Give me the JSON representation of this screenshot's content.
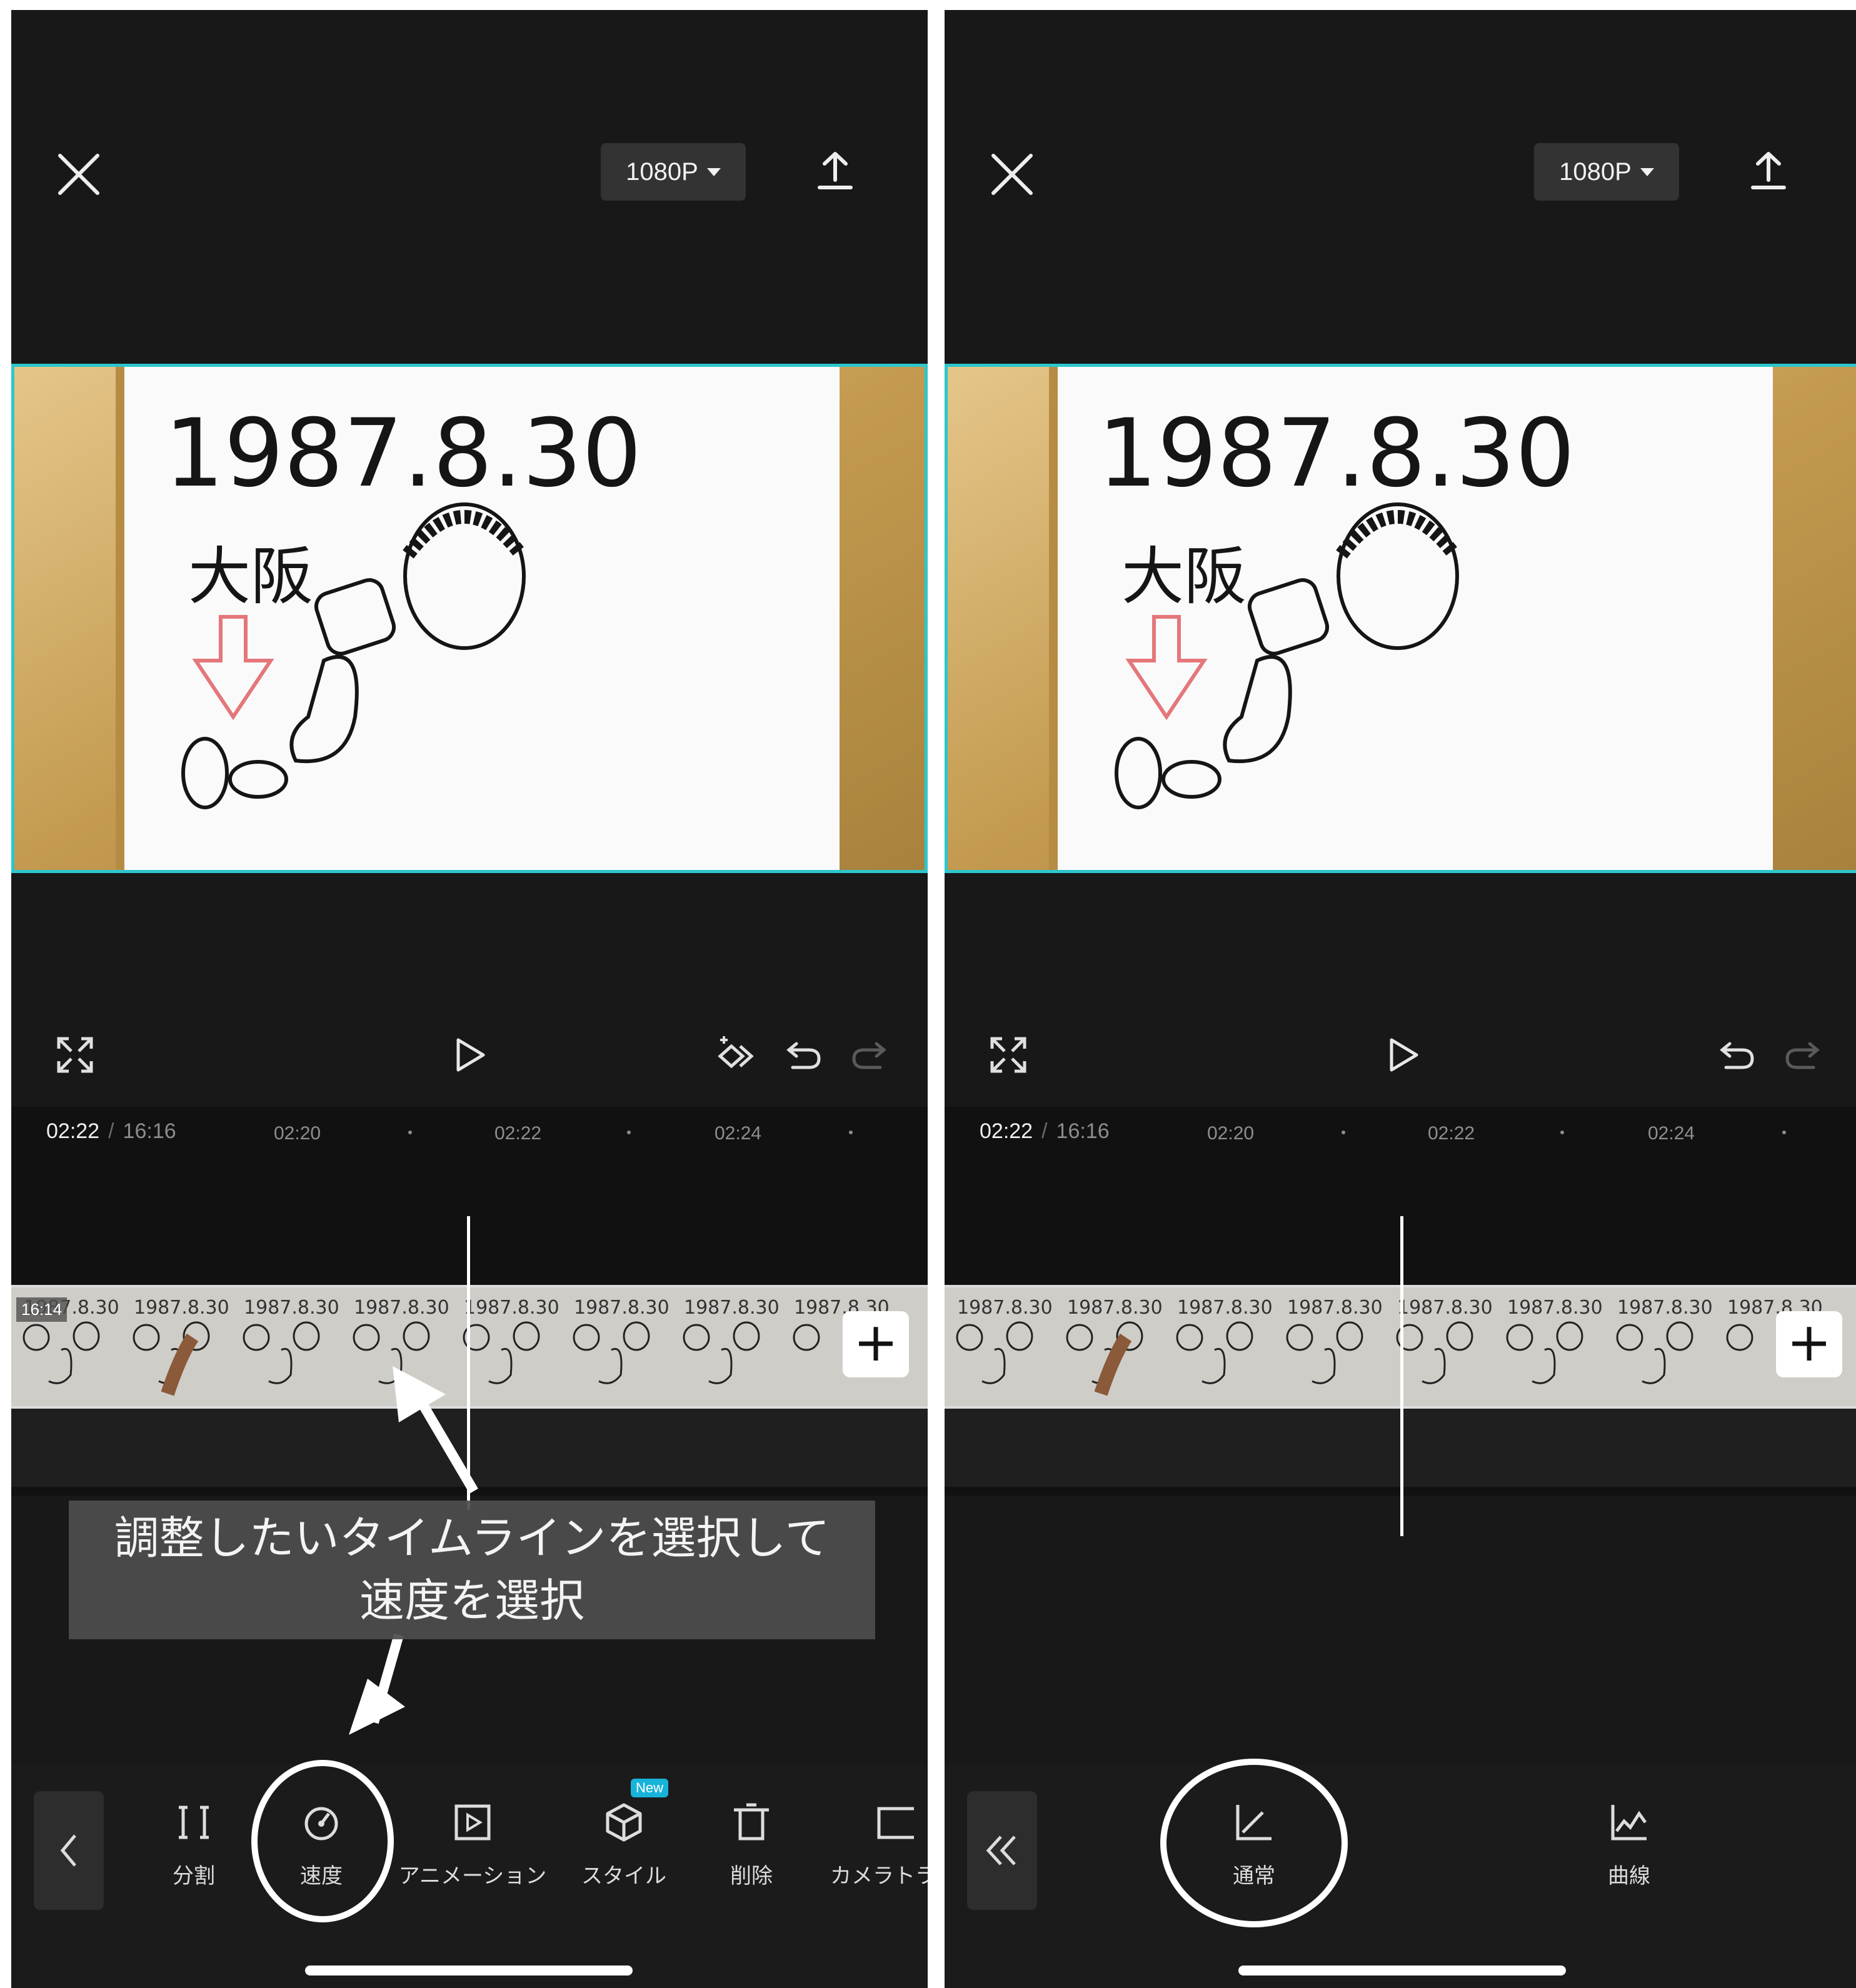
{
  "left_screen": {
    "resolution_label": "1080P",
    "time_current": "02:22",
    "time_separator": "/",
    "time_total": "16:16",
    "ruler_ticks": [
      "02:20",
      "02:22",
      "02:24"
    ],
    "clip_badge": "16:14",
    "frame_overlay_text": "1987.8.30",
    "caption_lines": [
      "調整したいタイムラインを選択して",
      "速度を選択"
    ],
    "tools": [
      {
        "label": "分割",
        "icon": "split-icon"
      },
      {
        "label": "速度",
        "icon": "speed-icon"
      },
      {
        "label": "アニメーション",
        "icon": "animation-icon"
      },
      {
        "label": "スタイル",
        "icon": "style-cube-icon",
        "badge": "New"
      },
      {
        "label": "削除",
        "icon": "delete-icon"
      },
      {
        "label": "カメラトラ",
        "icon": "camera-track-icon"
      }
    ]
  },
  "right_screen": {
    "resolution_label": "1080P",
    "time_current": "02:22",
    "time_separator": "/",
    "time_total": "16:16",
    "ruler_ticks": [
      "02:20",
      "02:22",
      "02:24"
    ],
    "frame_overlay_text": "1987.8.30",
    "tools": [
      {
        "label": "通常",
        "icon": "normal-speed-icon"
      },
      {
        "label": "曲線",
        "icon": "curve-speed-icon"
      }
    ]
  },
  "video_frame": {
    "date_text": "1987.8.30",
    "place_text": "大阪"
  },
  "colors": {
    "background": "#181818",
    "selection_border": "#2cc7cc",
    "new_badge": "#17b3d9",
    "caption_bg": "#4e4e4e"
  }
}
